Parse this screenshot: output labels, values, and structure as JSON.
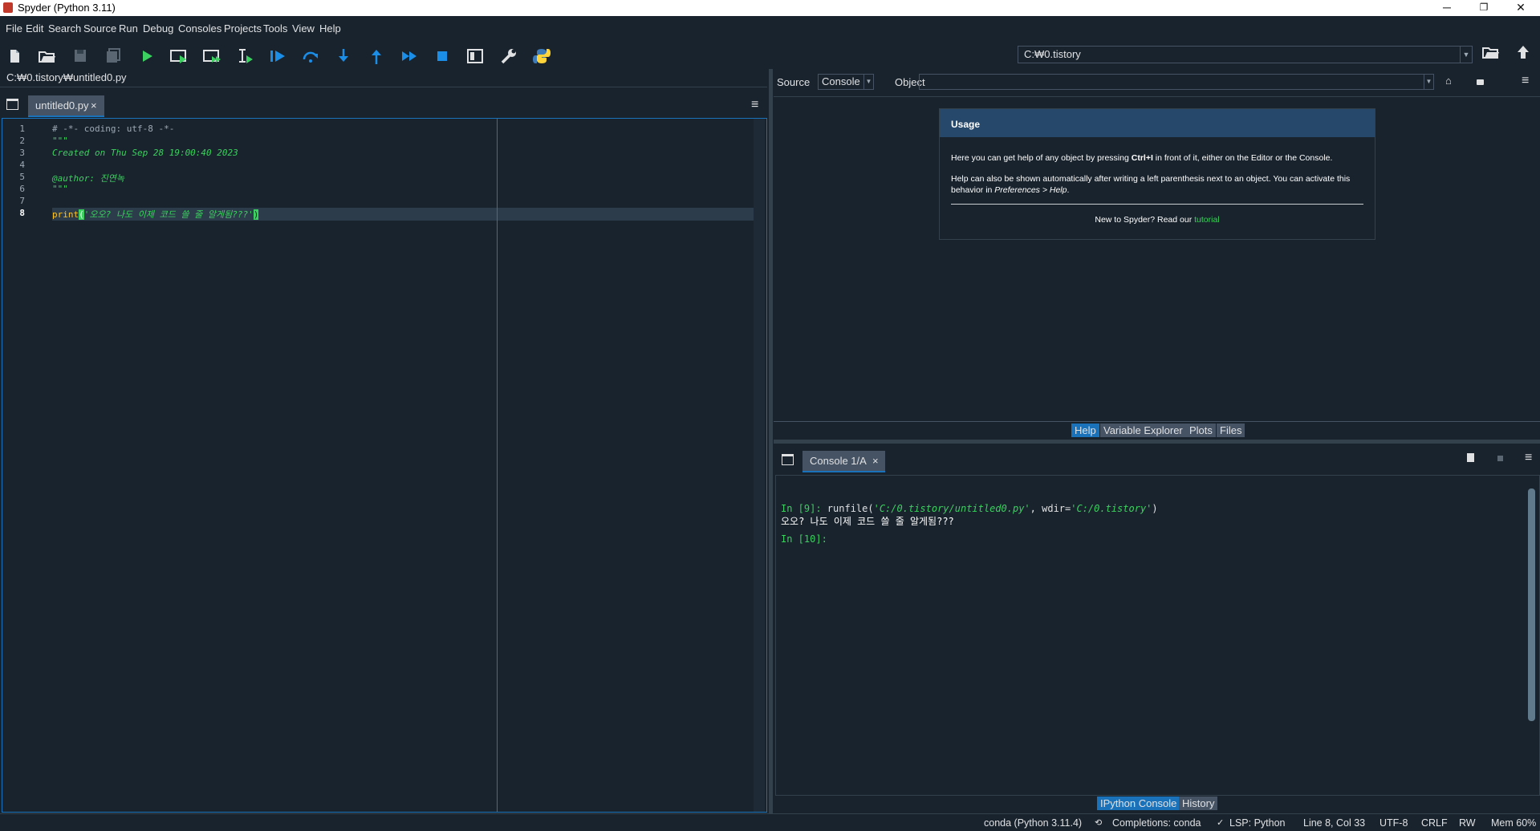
{
  "window": {
    "title": "Spyder (Python 3.11)",
    "minimize": "─",
    "restore": "❐",
    "close": "✕"
  },
  "menu": [
    "File",
    "Edit",
    "Search",
    "Source",
    "Run",
    "Debug",
    "Consoles",
    "Projects",
    "Tools",
    "View",
    "Help"
  ],
  "toolbar": {
    "icons": [
      "new-file-icon",
      "open-file-icon",
      "save-icon",
      "save-all-icon",
      "run-icon",
      "run-cell-icon",
      "run-cell-advance-icon",
      "run-selection-icon",
      "debug-icon",
      "debug-step-over-icon",
      "debug-step-into-icon",
      "debug-step-return-icon",
      "debug-continue-icon",
      "debug-stop-icon",
      "maximize-pane-icon",
      "preferences-icon",
      "python-path-icon"
    ],
    "working_dir": "C:₩0.tistory"
  },
  "editor": {
    "file_path": "C:₩0.tistory₩untitled0.py",
    "tab_label": "untitled0.py",
    "tab_close": "×",
    "current_line": 8,
    "lines": [
      {
        "n": "1",
        "text": "# -*- coding: utf-8 -*-"
      },
      {
        "n": "2",
        "text": "\"\"\""
      },
      {
        "n": "3",
        "text": "Created on Thu Sep 28 19:00:40 2023"
      },
      {
        "n": "4",
        "text": ""
      },
      {
        "n": "5",
        "text": "@author: 진연녹"
      },
      {
        "n": "6",
        "text": "\"\"\""
      },
      {
        "n": "7",
        "text": ""
      },
      {
        "n": "8",
        "text": "print('오오? 나도 이제 코드 쓸 줄 알게됨???')"
      }
    ],
    "code_line8": {
      "func": "print",
      "open": "(",
      "string": "'오오? 나도 이제 코드 쓸 줄 알게됨???'",
      "close": ")"
    }
  },
  "help": {
    "source_label": "Source",
    "source_value": "Console",
    "object_label": "Object",
    "object_value": "",
    "usage_title": "Usage",
    "usage_p1_pre": "Here you can get help of any object by pressing ",
    "usage_p1_key": "Ctrl+I",
    "usage_p1_post": " in front of it, either on the Editor or the Console.",
    "usage_p2_pre": "Help can also be shown automatically after writing a left parenthesis next to an object. You can activate this behavior in ",
    "usage_p2_em": "Preferences > Help",
    "usage_p2_post": ".",
    "tutorial_pre": "New to Spyder? Read our ",
    "tutorial_link": "tutorial",
    "tabs": [
      "Help",
      "Variable Explorer",
      "Plots",
      "Files"
    ],
    "active_tab": "Help"
  },
  "console": {
    "tab_label": "Console 1/A",
    "tab_close": "×",
    "in9_prompt": "In [9]: ",
    "in9_cmd_pre": "runfile(",
    "in9_arg1": "'C:/0.tistory/untitled0.py'",
    "in9_mid": ", wdir=",
    "in9_arg2": "'C:/0.tistory'",
    "in9_end": ")",
    "output": "오오? 나도 이제 코드 쓸 줄 알게됨???",
    "in10_prompt": "In [10]:",
    "tabs": [
      "IPython Console",
      "History"
    ],
    "active_tab": "IPython Console"
  },
  "status": {
    "env": "conda (Python 3.11.4)",
    "completions": "Completions: conda",
    "lsp": "LSP: Python",
    "position": "Line 8, Col 33",
    "encoding": "UTF-8",
    "eol": "CRLF",
    "rw": "RW",
    "mem": "Mem 60%"
  },
  "colors": {
    "background": "#19232d",
    "accent": "#1a72bb",
    "tab_bg": "#455364",
    "docstring": "#3bd05f",
    "builtin": "#ffc31f",
    "toolbar_icon": "#1b8ee8",
    "usage_header": "#26486b"
  }
}
